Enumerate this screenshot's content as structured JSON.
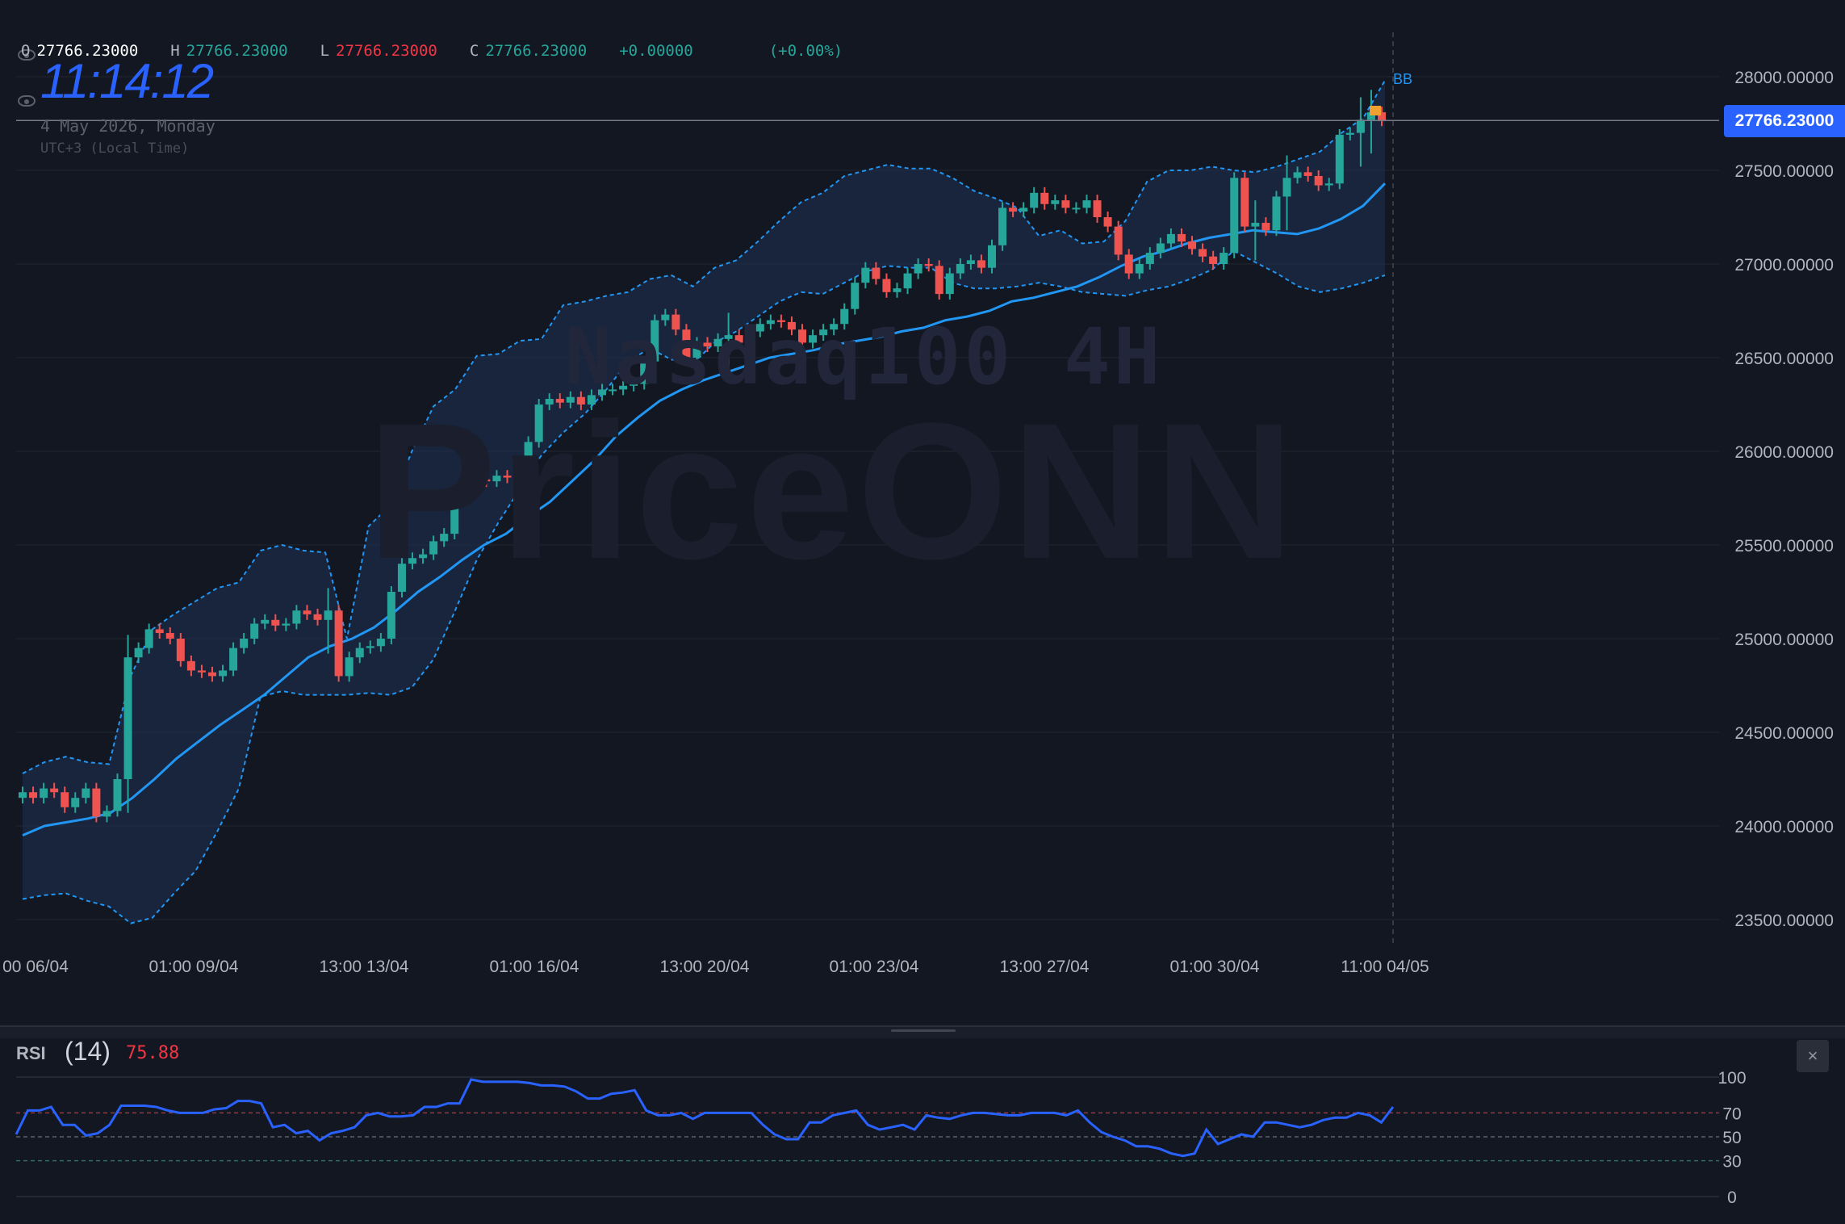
{
  "legend": {
    "o_label": "O",
    "o_value": "27766.23000",
    "h_label": "H",
    "h_value": "27766.23000",
    "l_label": "L",
    "l_value": "27766.23000",
    "c_label": "C",
    "c_value": "27766.23000",
    "change": "+0.00000",
    "change_pct": "(+0.00%)"
  },
  "clock": {
    "time": "11:14:12",
    "date": "4 May 2026, Monday",
    "timezone": "UTC+3 (Local Time)"
  },
  "watermark": {
    "title": "Nasdaq100 4H",
    "brand": "PriceONN"
  },
  "last_price_tag": "27766.23000",
  "bb_label": "BB",
  "rsi": {
    "label": "RSI",
    "length": "(14)",
    "value": "75.88",
    "close": "×"
  },
  "colors": {
    "up": "#26a69a",
    "down": "#ef5350",
    "bb": "#2196f3",
    "rsi_line": "#2962ff",
    "accent": "#2962ff",
    "background": "#131722"
  },
  "icons": {
    "visibility": "eye-icon",
    "close": "close-icon"
  },
  "chart_data": [
    {
      "type": "candlestick",
      "title": "Nasdaq100 4H",
      "xlabel": "",
      "ylabel": "",
      "ylim": [
        23400,
        28200
      ],
      "y_ticks": [
        "23500.00000",
        "24000.00000",
        "24500.00000",
        "25000.00000",
        "25500.00000",
        "26000.00000",
        "26500.00000",
        "27000.00000",
        "27500.00000",
        "28000.00000"
      ],
      "x_ticks": [
        "00 06/04",
        "01:00 09/04",
        "13:00 13/04",
        "01:00 16/04",
        "13:00 20/04",
        "01:00 23/04",
        "13:00 27/04",
        "01:00 30/04",
        "11:00 04/05"
      ],
      "grid": true,
      "last_price": 27766.23,
      "closes": [
        24180,
        24150,
        24200,
        24180,
        24100,
        24150,
        24200,
        24050,
        24080,
        24250,
        24900,
        24950,
        25050,
        25030,
        25000,
        24880,
        24830,
        24820,
        24800,
        24830,
        24950,
        25000,
        25080,
        25100,
        25070,
        25080,
        25150,
        25130,
        25100,
        25150,
        24800,
        24900,
        24950,
        24960,
        25000,
        25250,
        25400,
        25430,
        25450,
        25520,
        25560,
        25750,
        25820,
        25850,
        25840,
        25870,
        25860,
        25850,
        26050,
        26250,
        26280,
        26260,
        26290,
        26250,
        26300,
        26330,
        26330,
        26350,
        26360,
        26480,
        26700,
        26730,
        26650,
        26500,
        26580,
        26560,
        26600,
        26620,
        26580,
        26640,
        26680,
        26700,
        26690,
        26650,
        26580,
        26620,
        26650,
        26680,
        26760,
        26900,
        26980,
        26920,
        26850,
        26870,
        26950,
        27000,
        26990,
        26840,
        26950,
        27000,
        27020,
        26980,
        27100,
        27300,
        27280,
        27300,
        27380,
        27320,
        27340,
        27300,
        27300,
        27340,
        27250,
        27200,
        27050,
        26950,
        27000,
        27060,
        27110,
        27160,
        27120,
        27080,
        27040,
        27000,
        27060,
        27460,
        27200,
        27220,
        27180,
        27360,
        27460,
        27490,
        27470,
        27420,
        27430,
        27690,
        27700,
        27770,
        27810,
        27766
      ],
      "volatile_index": [
        10,
        29,
        67,
        117,
        120,
        127,
        128
      ],
      "bollinger": {
        "middle": [
          23950,
          24000,
          24020,
          24040,
          24070,
          24150,
          24250,
          24360,
          24450,
          24540,
          24620,
          24700,
          24800,
          24900,
          24960,
          25000,
          25060,
          25150,
          25250,
          25330,
          25420,
          25500,
          25560,
          25650,
          25730,
          25840,
          25950,
          26080,
          26180,
          26270,
          26330,
          26380,
          26420,
          26460,
          26500,
          26520,
          26540,
          26570,
          26590,
          26610,
          26640,
          26660,
          26700,
          26720,
          26750,
          26800,
          26820,
          26850,
          26880,
          26930,
          26990,
          27040,
          27070,
          27110,
          27140,
          27160,
          27180,
          27170,
          27160,
          27190,
          27240,
          27310,
          27430
        ],
        "upper": [
          24280,
          24340,
          24370,
          24340,
          24330,
          24800,
          25050,
          25130,
          25200,
          25270,
          25300,
          25470,
          25500,
          25470,
          25460,
          25000,
          25600,
          25710,
          26000,
          26240,
          26330,
          26510,
          26520,
          26590,
          26600,
          26780,
          26800,
          26830,
          26850,
          26920,
          26940,
          26880,
          26980,
          27020,
          27120,
          27230,
          27330,
          27380,
          27470,
          27500,
          27530,
          27510,
          27510,
          27460,
          27390,
          27350,
          27300,
          27150,
          27180,
          27110,
          27120,
          27230,
          27440,
          27500,
          27500,
          27520,
          27500,
          27490,
          27520,
          27560,
          27600,
          27700,
          27780,
          27980
        ],
        "lower": [
          23610,
          23630,
          23640,
          23600,
          23570,
          23480,
          23510,
          23640,
          23760,
          23970,
          24200,
          24690,
          24720,
          24700,
          24700,
          24700,
          24710,
          24700,
          24740,
          24890,
          25150,
          25420,
          25620,
          25800,
          25980,
          26100,
          26200,
          26330,
          26480,
          26550,
          26490,
          26470,
          26580,
          26640,
          26720,
          26800,
          26850,
          26840,
          26900,
          26960,
          26990,
          26980,
          26980,
          26900,
          26870,
          26870,
          26880,
          26900,
          26880,
          26850,
          26840,
          26830,
          26860,
          26880,
          26920,
          26970,
          27070,
          27010,
          26950,
          26880,
          26850,
          26870,
          26900,
          26940
        ]
      }
    },
    {
      "type": "line",
      "title": "RSI (14)",
      "ylim": [
        0,
        100
      ],
      "y_ticks": [
        "100",
        "70",
        "50",
        "30",
        "0"
      ],
      "levels": [
        70,
        50,
        30
      ],
      "values": [
        52,
        72,
        72,
        75,
        60,
        60,
        51,
        53,
        60,
        76,
        76,
        76,
        75,
        72,
        70,
        70,
        70,
        73,
        74,
        80,
        80,
        78,
        58,
        60,
        53,
        55,
        47,
        53,
        55,
        58,
        68,
        70,
        67,
        67,
        68,
        75,
        75,
        78,
        78,
        98,
        96,
        96,
        96,
        96,
        95,
        93,
        93,
        92,
        88,
        82,
        82,
        86,
        87,
        89,
        72,
        68,
        68,
        70,
        65,
        70,
        70,
        70,
        70,
        70,
        60,
        52,
        48,
        48,
        62,
        62,
        68,
        70,
        72,
        60,
        56,
        58,
        60,
        56,
        68,
        66,
        65,
        68,
        70,
        70,
        69,
        68,
        68,
        70,
        70,
        70,
        68,
        72,
        62,
        54,
        50,
        47,
        42,
        42,
        40,
        36,
        34,
        36,
        56,
        44,
        48,
        52,
        50,
        62,
        62,
        60,
        58,
        60,
        64,
        66,
        66,
        70,
        68,
        62,
        75
      ]
    }
  ]
}
